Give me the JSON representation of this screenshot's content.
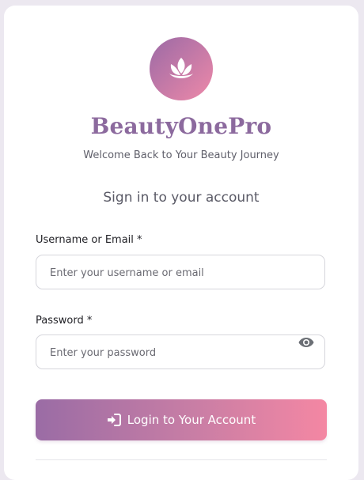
{
  "brand": {
    "name": "BeautyOnePro",
    "tagline": "Welcome Back to Your Beauty Journey",
    "logo_icon": "lotus-icon"
  },
  "form": {
    "heading": "Sign in to your account",
    "username": {
      "label": "Username or Email *",
      "placeholder": "Enter your username or email",
      "value": ""
    },
    "password": {
      "label": "Password *",
      "placeholder": "Enter your password",
      "value": "",
      "toggle_icon": "eye-icon"
    },
    "submit": {
      "label": "Login to Your Account",
      "icon": "sign-in-icon"
    }
  },
  "colors": {
    "brand_text": "#8c6a9e",
    "gradient_start": "#9a6ca5",
    "gradient_end": "#f487a3"
  }
}
